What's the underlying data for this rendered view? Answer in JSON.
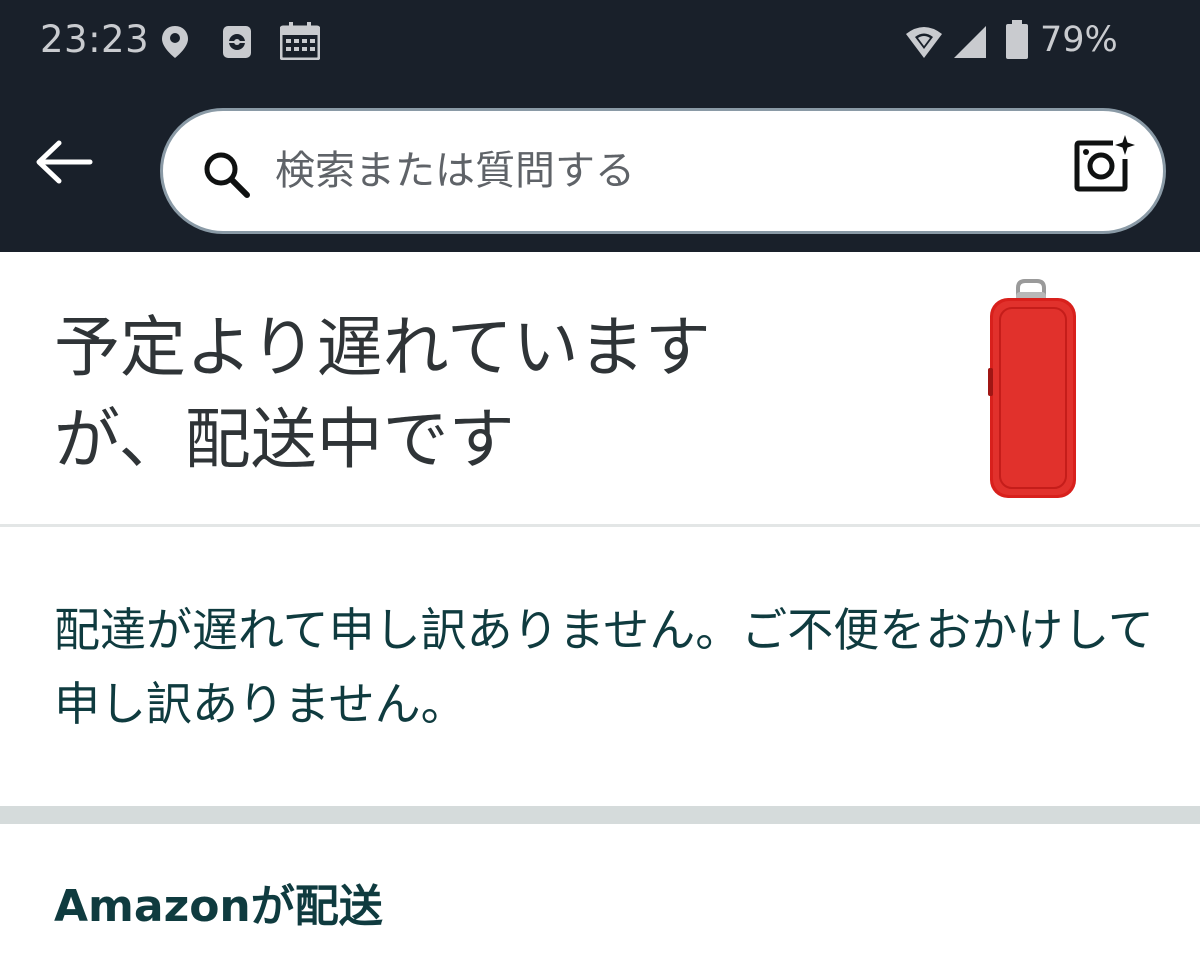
{
  "status_bar": {
    "time": "23:23",
    "battery_percent": "79%",
    "icons": [
      "location-icon",
      "app-notification-icon",
      "calendar-icon",
      "wifi-icon",
      "cellular-signal-icon",
      "battery-icon"
    ]
  },
  "header": {
    "back_icon": "back-arrow-icon",
    "search": {
      "placeholder": "検索または質問する",
      "value": ""
    },
    "camera_icon": "camera-search-icon"
  },
  "shipment": {
    "title_line1": "予定より遅れています",
    "title_line2": "が、配送中です",
    "product_image": "red-hard-case-image",
    "apology_message": "配達が遅れて申し訳ありません。ご不便をおかけして申し訳ありません。",
    "carrier": "Amazonが配送"
  },
  "colors": {
    "header_bg": "#19202a",
    "title_text": "#2f3437",
    "message_text": "#0f3b3f",
    "product_red": "#e1312c"
  }
}
